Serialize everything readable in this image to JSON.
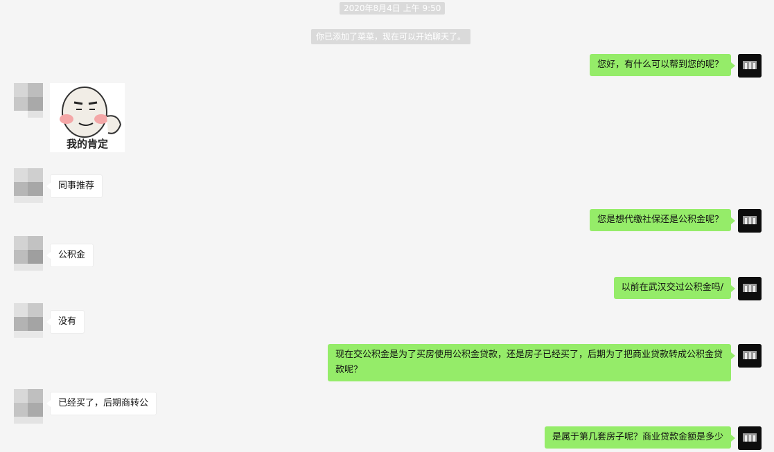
{
  "chat": {
    "timestamp": "2020年8月4日 上午 9:50",
    "system_message": "你已添加了菜菜，现在可以开始聊天了。",
    "messages": [
      {
        "side": "right",
        "type": "text",
        "text": "您好，有什么可以帮到您的呢？"
      },
      {
        "side": "left",
        "type": "sticker",
        "caption": "我的肯定"
      },
      {
        "side": "left",
        "type": "text",
        "text": "同事推荐"
      },
      {
        "side": "right",
        "type": "text",
        "text": "您是想代缴社保还是公积金呢？"
      },
      {
        "side": "left",
        "type": "text",
        "text": "公积金"
      },
      {
        "side": "right",
        "type": "text",
        "text": "以前在武汉交过公积金吗/"
      },
      {
        "side": "left",
        "type": "text",
        "text": "没有"
      },
      {
        "side": "right",
        "type": "text",
        "text": "现在交公积金是为了买房使用公积金贷款，还是房子已经买了，后期为了把商业贷款转成公积金贷款呢？"
      },
      {
        "side": "left",
        "type": "text",
        "text": "已经买了，后期商转公"
      },
      {
        "side": "right",
        "type": "text",
        "text": "是属于第几套房子呢？商业贷款金额是多少"
      }
    ]
  },
  "colors": {
    "background": "#f5f5f5",
    "sent_bubble": "#95ec69",
    "received_bubble": "#ffffff",
    "system_pill": "#dadada"
  },
  "icons": {
    "self_avatar": "avatar-dark-image",
    "contact_avatar": "avatar-pixelated"
  }
}
